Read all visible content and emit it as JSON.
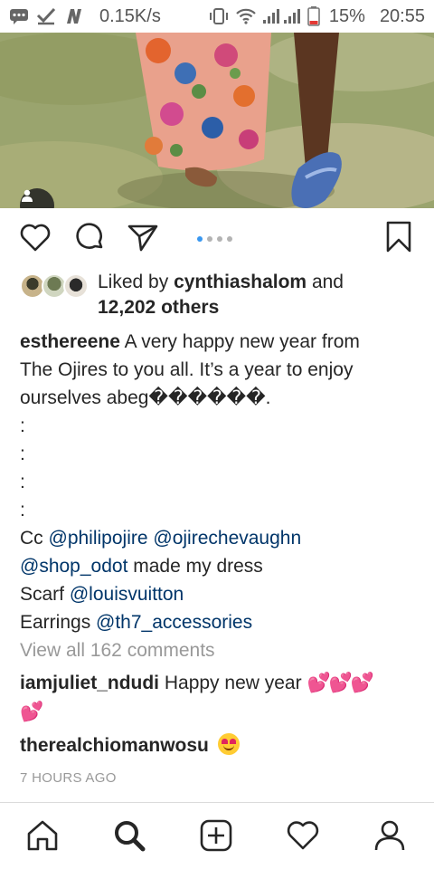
{
  "status_bar": {
    "network_speed": "0.15K/s",
    "battery": "15%",
    "time": "20:55",
    "icons": [
      "message-icon",
      "check-icon",
      "n-icon",
      "vibrate-icon",
      "wifi-icon",
      "signal-icon",
      "battery-icon"
    ]
  },
  "post": {
    "carousel": {
      "total": 4,
      "active_index": 0
    },
    "likes": {
      "prefix": "Liked by ",
      "user": "cynthiashalom",
      "middle": " and",
      "count_text": "12,202 others"
    },
    "caption": {
      "author": "esthereene",
      "text1": " A very happy new year from",
      "text2": "The Ojires to you all. It’s a year to enjoy",
      "text3": "ourselves abeg������.",
      "colon": ":",
      "cc_label": "Cc ",
      "mention1": "@philipojire",
      "space": " ",
      "mention2": "@ojirechevaughn",
      "mention3": "@shop_odot",
      "dress_text": " made my dress",
      "scarf_label": "Scarf ",
      "mention4": "@louisvuitton",
      "earrings_label": "Earrings ",
      "mention5": "@th7_accessories"
    },
    "view_comments": "View all 162 comments",
    "comments": [
      {
        "user": "iamjuliet_ndudi",
        "text": " Happy new year ",
        "emoji": "💕💕💕",
        "emoji2": "💕"
      },
      {
        "user": "therealchiomanwosu",
        "text": "",
        "emoji": "😍"
      }
    ],
    "time_ago": "7 HOURS AGO"
  },
  "bottom_nav": {
    "items": [
      "home-icon",
      "search-icon",
      "add-icon",
      "heart-icon",
      "profile-icon"
    ]
  },
  "colors": {
    "mention": "#003569",
    "muted": "#999999",
    "active_dot": "#3897f0",
    "text": "#262626"
  }
}
